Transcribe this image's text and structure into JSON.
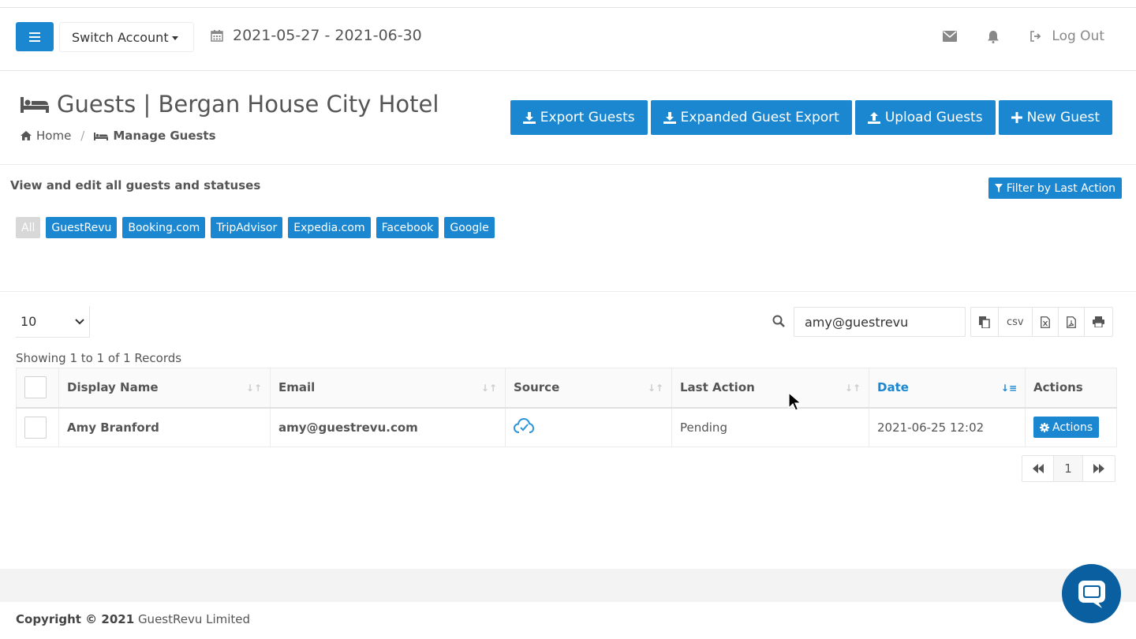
{
  "header": {
    "switch_account": "Switch Account",
    "date_range": "2021-05-27 - 2021-06-30",
    "logout": "Log Out"
  },
  "page": {
    "title": "Guests | Bergan House City Hotel",
    "breadcrumb_home": "Home",
    "breadcrumb_current": "Manage Guests",
    "buttons": {
      "export": "Export Guests",
      "expanded_export": "Expanded Guest Export",
      "upload": "Upload Guests",
      "new": "New Guest"
    }
  },
  "section": {
    "subtitle": "View and edit all guests and statuses",
    "filter_button": "Filter by Last Action",
    "sources": [
      "All",
      "GuestRevu",
      "Booking.com",
      "TripAdvisor",
      "Expedia.com",
      "Facebook",
      "Google"
    ]
  },
  "table": {
    "page_size": "10",
    "search_value": "amy@guestrevu",
    "tools": {
      "csv": "csv"
    },
    "showing": "Showing 1 to 1 of 1 Records",
    "columns": [
      "Display Name",
      "Email",
      "Source",
      "Last Action",
      "Date",
      "Actions"
    ],
    "rows": [
      {
        "display_name": "Amy Branford",
        "email": "amy@guestrevu.com",
        "source": "guestrevu-icon",
        "last_action": "Pending",
        "date": "2021-06-25 12:02",
        "actions": "Actions"
      }
    ],
    "current_page": "1"
  },
  "footer": {
    "copyright_bold": "Copyright © 2021",
    "company": "GuestRevu Limited"
  },
  "colors": {
    "primary": "#1a87d0",
    "chat": "#0a5fa0"
  }
}
